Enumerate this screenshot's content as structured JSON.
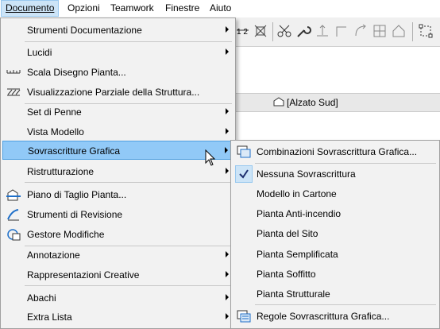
{
  "menubar": {
    "items": [
      "Documento",
      "Opzioni",
      "Teamwork",
      "Finestre",
      "Aiuto"
    ]
  },
  "viewbar": {
    "label": "[Alzato Sud]"
  },
  "main_menu": {
    "items": [
      {
        "label": "Strumenti Documentazione",
        "submenu": true
      },
      {
        "label": "Lucidi",
        "submenu": true
      },
      {
        "label": "Scala Disegno Pianta...",
        "icon": "scale-icon"
      },
      {
        "label": "Visualizzazione Parziale della Struttura...",
        "icon": "hatch-icon"
      },
      {
        "label": "Set di Penne",
        "submenu": true
      },
      {
        "label": "Vista Modello",
        "submenu": true
      },
      {
        "label": "Sovrascritture Grafica",
        "submenu": true,
        "highlighted": true
      },
      {
        "label": "Ristrutturazione",
        "submenu": true
      },
      {
        "label": "Piano di Taglio Pianta...",
        "icon": "cut-plane-icon"
      },
      {
        "label": "Strumenti di Revisione",
        "icon": "revision-icon"
      },
      {
        "label": "Gestore Modifiche",
        "icon": "change-manager-icon"
      },
      {
        "label": "Annotazione",
        "submenu": true
      },
      {
        "label": "Rappresentazioni Creative",
        "submenu": true
      },
      {
        "label": "Abachi",
        "submenu": true
      },
      {
        "label": "Extra Lista",
        "submenu": true
      }
    ]
  },
  "sub_menu": {
    "items": [
      {
        "label": "Combinazioni Sovrascrittura Grafica...",
        "icon": "combination-icon"
      },
      {
        "label": "Nessuna Sovrascrittura",
        "checked": true
      },
      {
        "label": "Modello in Cartone"
      },
      {
        "label": "Pianta Anti-incendio"
      },
      {
        "label": "Pianta del Sito"
      },
      {
        "label": "Pianta Semplificata"
      },
      {
        "label": "Pianta Soffitto"
      },
      {
        "label": "Pianta Strutturale"
      },
      {
        "label": "Regole Sovrascrittura Grafica...",
        "icon": "rules-icon"
      }
    ]
  },
  "colors": {
    "highlight": "#91c9f7",
    "highlight_border": "#4d9fe0",
    "menu_bg": "#f2f2f2"
  }
}
